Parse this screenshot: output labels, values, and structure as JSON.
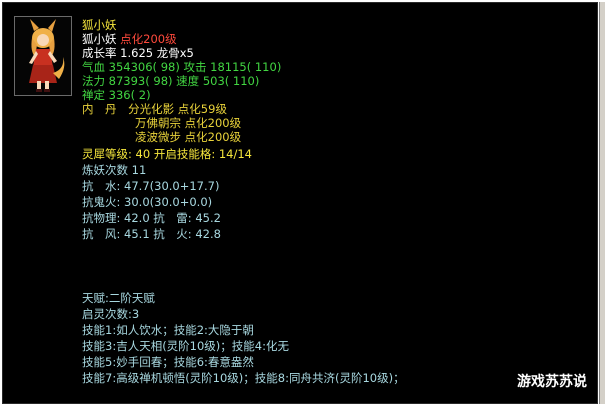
{
  "pet": {
    "title": "狐小妖",
    "name": "狐小妖",
    "name_mod": "点化200级",
    "growth_label": "成长率",
    "growth_value": "1.625",
    "growth_extra": "龙骨x5",
    "hp_label": "气血",
    "hp_value": "354306( 98)",
    "atk_label": "攻击",
    "atk_value": "18115( 110)",
    "mp_label": "法力",
    "mp_value": "87393( 98)",
    "spd_label": "速度",
    "spd_value": "503( 110)",
    "focus_label": "禅定",
    "focus_value": "336( 2)",
    "neidan_label": "内　丹",
    "neidan_items": [
      "分光化影 点化59级",
      "万佛朝宗 点化200级",
      "凌波微步 点化200级"
    ],
    "spirit_line": "灵犀等级: 40 开启技能格: 14/14",
    "refine_line": "炼妖次数 11",
    "resist_water": "抗　水: 47.7(30.0+17.7)",
    "resist_ghost": "抗鬼火: 30.0(30.0+0.0)",
    "resist_phys_thunder": "抗物理: 42.0 抗　雷: 45.2",
    "resist_wind_fire": "抗　风: 45.1 抗　火: 42.8",
    "talent": "天赋:二阶天赋",
    "awaken": "启灵次数:3",
    "skills_1": "技能1:如人饮水；技能2:大隐于朝",
    "skills_2": "技能3:吉人天相(灵阶10级)；技能4:化无",
    "skills_3": "技能5:妙手回春；技能6:春意盎然",
    "skills_4": "技能7:高级禅机顿悟(灵阶10级)；技能8:同舟共济(灵阶10级)；"
  },
  "watermark": "游戏苏苏说",
  "colors": {
    "title": "#f5e63c",
    "value_green": "#42d642",
    "mod_red": "#ff4a3c",
    "info_cyan": "#a8d8e0",
    "background": "#000000"
  }
}
